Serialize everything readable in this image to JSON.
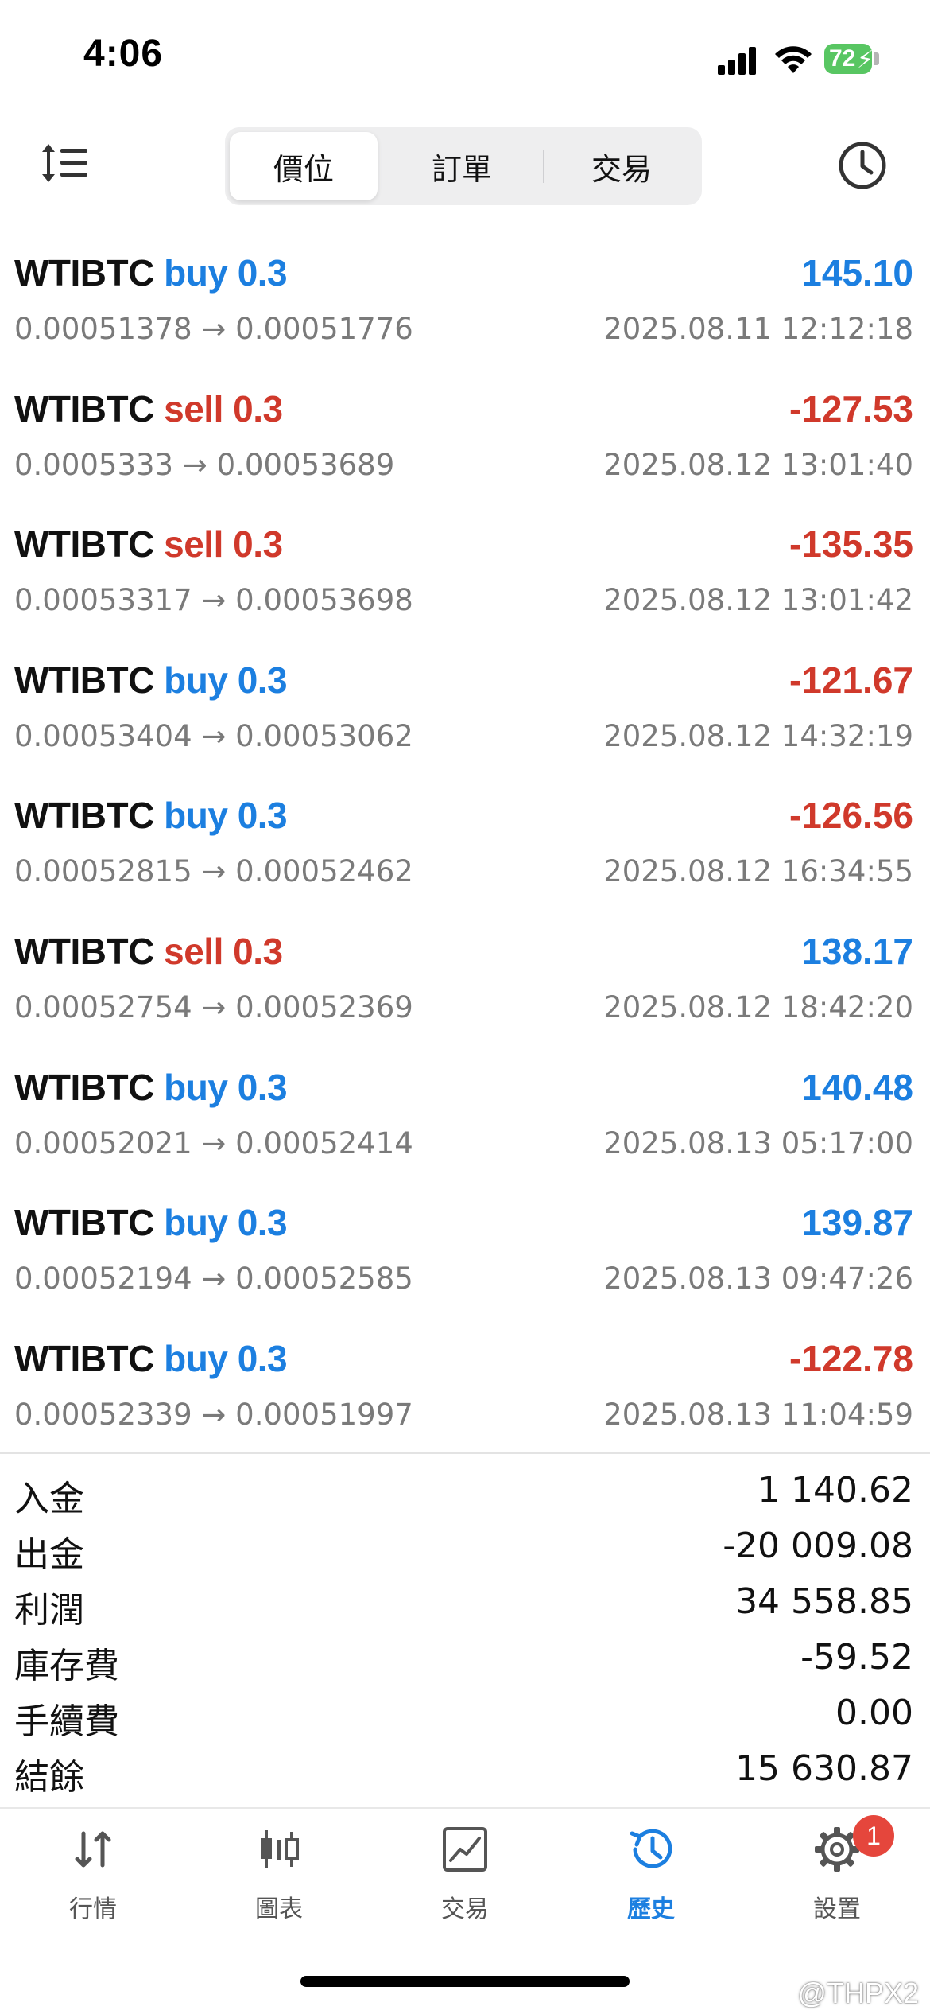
{
  "status_bar": {
    "time": "4:06",
    "battery": "72"
  },
  "toolbar": {
    "tabs": [
      {
        "label": "價位",
        "active": true
      },
      {
        "label": "訂單",
        "active": false
      },
      {
        "label": "交易",
        "active": false
      }
    ],
    "sort_icon": "sort-list-icon",
    "history_icon": "clock-icon"
  },
  "colors": {
    "buy": "#1c7fe0",
    "sell": "#d0392b",
    "positive": "#1c7fe0",
    "negative": "#d0392b",
    "active_tab": "#1c7fe0"
  },
  "deals": [
    {
      "symbol": "WTIBTC",
      "type": "buy",
      "volume": "0.3",
      "prices": "0.00051378 → 0.00051776",
      "profit": "145.10",
      "time": "2025.08.11 12:12:18"
    },
    {
      "symbol": "WTIBTC",
      "type": "sell",
      "volume": "0.3",
      "prices": "0.0005333 → 0.00053689",
      "profit": "-127.53",
      "time": "2025.08.12 13:01:40"
    },
    {
      "symbol": "WTIBTC",
      "type": "sell",
      "volume": "0.3",
      "prices": "0.00053317 → 0.00053698",
      "profit": "-135.35",
      "time": "2025.08.12 13:01:42"
    },
    {
      "symbol": "WTIBTC",
      "type": "buy",
      "volume": "0.3",
      "prices": "0.00053404 → 0.00053062",
      "profit": "-121.67",
      "time": "2025.08.12 14:32:19"
    },
    {
      "symbol": "WTIBTC",
      "type": "buy",
      "volume": "0.3",
      "prices": "0.00052815 → 0.00052462",
      "profit": "-126.56",
      "time": "2025.08.12 16:34:55"
    },
    {
      "symbol": "WTIBTC",
      "type": "sell",
      "volume": "0.3",
      "prices": "0.00052754 → 0.00052369",
      "profit": "138.17",
      "time": "2025.08.12 18:42:20"
    },
    {
      "symbol": "WTIBTC",
      "type": "buy",
      "volume": "0.3",
      "prices": "0.00052021 → 0.00052414",
      "profit": "140.48",
      "time": "2025.08.13 05:17:00"
    },
    {
      "symbol": "WTIBTC",
      "type": "buy",
      "volume": "0.3",
      "prices": "0.00052194 → 0.00052585",
      "profit": "139.87",
      "time": "2025.08.13 09:47:26"
    },
    {
      "symbol": "WTIBTC",
      "type": "buy",
      "volume": "0.3",
      "prices": "0.00052339 → 0.00051997",
      "profit": "-122.78",
      "time": "2025.08.13 11:04:59"
    }
  ],
  "summary": [
    {
      "label": "入金",
      "value": "1 140.62"
    },
    {
      "label": "出金",
      "value": "-20 009.08"
    },
    {
      "label": "利潤",
      "value": "34 558.85"
    },
    {
      "label": "庫存費",
      "value": "-59.52"
    },
    {
      "label": "手續費",
      "value": "0.00"
    },
    {
      "label": "結餘",
      "value": "15 630.87"
    }
  ],
  "tabbar": [
    {
      "label": "行情",
      "icon": "quotes-arrows-icon",
      "active": false
    },
    {
      "label": "圖表",
      "icon": "candlestick-chart-icon",
      "active": false
    },
    {
      "label": "交易",
      "icon": "trade-chart-icon",
      "active": false
    },
    {
      "label": "歷史",
      "icon": "history-clock-icon",
      "active": true
    },
    {
      "label": "設置",
      "icon": "gear-icon",
      "active": false,
      "badge": "1"
    }
  ],
  "watermark": "@THPX2"
}
